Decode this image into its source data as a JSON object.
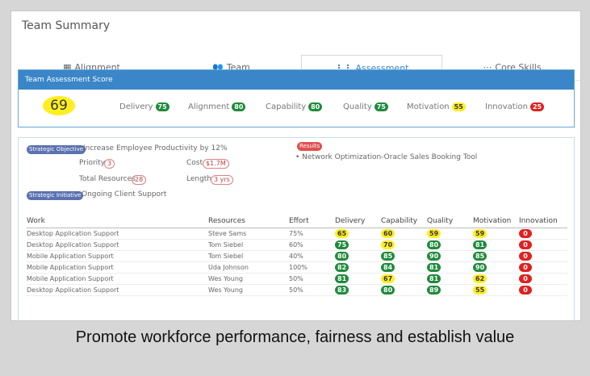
{
  "page": {
    "title": "Team Summary"
  },
  "tabs": [
    {
      "label": "Alignment",
      "icon": "table-icon"
    },
    {
      "label": "Team",
      "icon": "users-icon"
    },
    {
      "label": "Assessment",
      "icon": "bars-icon",
      "active": true
    },
    {
      "label": "Core Skills",
      "icon": "dots-icon"
    }
  ],
  "score_panel": {
    "header": "Team Assessment Score",
    "overall": "69",
    "metrics": [
      {
        "label": "Delivery",
        "value": "75",
        "color": "#1f8a3b"
      },
      {
        "label": "Alignment",
        "value": "80",
        "color": "#1f8a3b"
      },
      {
        "label": "Capability",
        "value": "80",
        "color": "#1f8a3b"
      },
      {
        "label": "Quality",
        "value": "75",
        "color": "#1f8a3b"
      },
      {
        "label": "Motivation",
        "value": "55",
        "color": "#ffee22"
      },
      {
        "label": "Innovation",
        "value": "25",
        "color": "#e02020"
      }
    ]
  },
  "details": {
    "objective_tag": "Strategic Objective",
    "objective_text": "Increase Employee Productivity by 12%",
    "priority_label": "Priority",
    "priority_value": "3",
    "cost_label": "Cost",
    "cost_value": "$1.7M",
    "resources_label": "Total Resources",
    "resources_value": "28",
    "length_label": "Length",
    "length_value": "3 yrs",
    "initiative_tag": "Strategic Initiative",
    "initiative_text": "Ongoing Client Support",
    "results_tag": "Results",
    "results_item": "Network Optimization-Oracle Sales Booking Tool"
  },
  "table": {
    "headers": [
      "Work",
      "Resources",
      "Effort",
      "Delivery",
      "Capability",
      "Quality",
      "Motivation",
      "Innovation"
    ],
    "rows": [
      {
        "work": "Desktop Application Support",
        "resource": "Steve Sams",
        "effort": "75%",
        "scores": [
          [
            "65",
            "y"
          ],
          [
            "60",
            "y"
          ],
          [
            "59",
            "y"
          ],
          [
            "59",
            "y"
          ],
          [
            "0",
            "r"
          ]
        ]
      },
      {
        "work": "Desktop Application Support",
        "resource": "Tom Siebel",
        "effort": "60%",
        "scores": [
          [
            "75",
            "g"
          ],
          [
            "70",
            "y"
          ],
          [
            "80",
            "g"
          ],
          [
            "81",
            "g"
          ],
          [
            "0",
            "r"
          ]
        ]
      },
      {
        "work": "Mobile Application Support",
        "resource": "Tom Siebel",
        "effort": "40%",
        "scores": [
          [
            "80",
            "g"
          ],
          [
            "85",
            "g"
          ],
          [
            "90",
            "g"
          ],
          [
            "85",
            "g"
          ],
          [
            "0",
            "r"
          ]
        ]
      },
      {
        "work": "Mobile Application Support",
        "resource": "Uda Johnson",
        "effort": "100%",
        "scores": [
          [
            "82",
            "g"
          ],
          [
            "84",
            "g"
          ],
          [
            "81",
            "g"
          ],
          [
            "90",
            "g"
          ],
          [
            "0",
            "r"
          ]
        ]
      },
      {
        "work": "Mobile Application Support",
        "resource": "Wes Young",
        "effort": "50%",
        "scores": [
          [
            "81",
            "g"
          ],
          [
            "67",
            "y"
          ],
          [
            "81",
            "g"
          ],
          [
            "62",
            "y"
          ],
          [
            "0",
            "r"
          ]
        ]
      },
      {
        "work": "Desktop Application Support",
        "resource": "Wes Young",
        "effort": "50%",
        "scores": [
          [
            "83",
            "g"
          ],
          [
            "80",
            "g"
          ],
          [
            "89",
            "g"
          ],
          [
            "55",
            "y"
          ],
          [
            "0",
            "r"
          ]
        ]
      }
    ]
  },
  "caption": "Promote workforce performance, fairness and establish value"
}
